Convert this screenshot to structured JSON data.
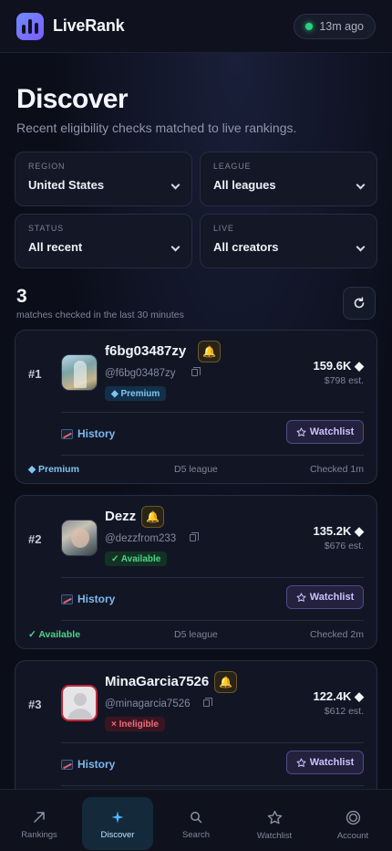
{
  "header": {
    "app_name": "LiveRank",
    "updated": "13m ago"
  },
  "page": {
    "title": "Discover",
    "subtitle": "Recent eligibility checks matched to live rankings."
  },
  "filters": [
    {
      "label": "REGION",
      "value": "United States"
    },
    {
      "label": "LEAGUE",
      "value": "All leagues"
    },
    {
      "label": "STATUS",
      "value": "All recent"
    },
    {
      "label": "LIVE",
      "value": "All creators"
    }
  ],
  "summary": {
    "count": "3",
    "caption": "matches checked in the last 30 minutes"
  },
  "cards": [
    {
      "rank": "#1",
      "username": "f6bg03487zy",
      "handle": "@f6bg03487zy",
      "badge": "◆ Premium",
      "badge_type": "premium",
      "value": "159.6K ◆",
      "estimate": "$798 est.",
      "history": "History",
      "watch": "Watchlist",
      "footer_status": "◆ Premium",
      "league": "D5 league",
      "checked": "Checked 1m"
    },
    {
      "rank": "#2",
      "username": "Dezz",
      "handle": "@dezzfrom233",
      "badge": "✓ Available",
      "badge_type": "available",
      "value": "135.2K ◆",
      "estimate": "$676 est.",
      "history": "History",
      "watch": "Watchlist",
      "footer_status": "✓ Available",
      "league": "D5 league",
      "checked": "Checked 2m"
    },
    {
      "rank": "#3",
      "username": "MinaGarcia7526",
      "handle": "@minagarcia7526",
      "badge": "× Ineligible",
      "badge_type": "ineligible",
      "value": "122.4K ◆",
      "estimate": "$612 est.",
      "history": "History",
      "watch": "Watchlist"
    }
  ],
  "tabs": [
    {
      "label": "Rankings",
      "icon": "trend-arrow-icon"
    },
    {
      "label": "Discover",
      "icon": "sparkle-icon",
      "active": true
    },
    {
      "label": "Search",
      "icon": "search-icon"
    },
    {
      "label": "Watchlist",
      "icon": "star-icon"
    },
    {
      "label": "Account",
      "icon": "account-icon"
    }
  ],
  "colors": {
    "background": "#0b0e19",
    "accent": "#6f8cff",
    "premium": "#7cc7f2",
    "available": "#4fd38a",
    "ineligible": "#f06a7c",
    "live": "#27d27b"
  }
}
